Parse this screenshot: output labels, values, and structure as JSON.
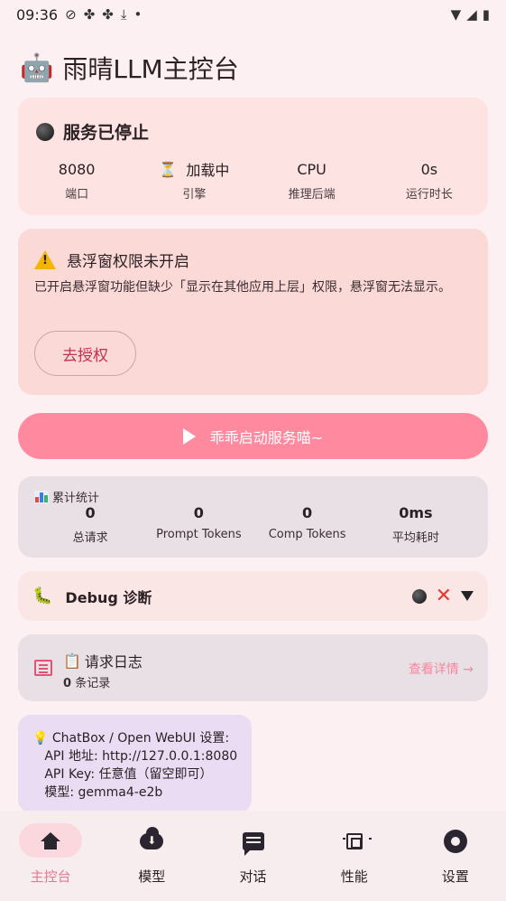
{
  "status_bar": {
    "time": "09:36",
    "notif_icons": [
      "hotspot-icon",
      "pinwheel-icon",
      "pinwheel-icon",
      "download-icon",
      "dot-icon"
    ],
    "system_icons": [
      "wifi-icon",
      "signal-icon",
      "battery-icon"
    ]
  },
  "app": {
    "title": "雨晴LLM主控台"
  },
  "service": {
    "status": "服务已停止",
    "stats": [
      {
        "value": "8080",
        "label": "端口"
      },
      {
        "value": "加载中",
        "label": "引擎"
      },
      {
        "value": "CPU",
        "label": "推理后端"
      },
      {
        "value": "0s",
        "label": "运行时长"
      }
    ]
  },
  "warning": {
    "title": "悬浮窗权限未开启",
    "body": "已开启悬浮窗功能但缺少「显示在其他应用上层」权限，悬浮窗无法显示。",
    "button": "去授权"
  },
  "start_button": {
    "label": "乖乖启动服务喵~"
  },
  "totals": {
    "title": "累计统计",
    "items": [
      {
        "value": "0",
        "label": "总请求"
      },
      {
        "value": "0",
        "label": "Prompt Tokens"
      },
      {
        "value": "0",
        "label": "Comp Tokens"
      },
      {
        "value": "0ms",
        "label": "平均耗时"
      }
    ]
  },
  "debug": {
    "title": "Debug 诊断"
  },
  "request_log": {
    "title": "请求日志",
    "count": "0",
    "count_suffix": "条记录",
    "link": "查看详情 →"
  },
  "tip": {
    "lines": "💡 ChatBox / Open WebUI 设置:\n   API 地址: http://127.0.0.1:8080\n   API Key: 任意值（留空即可）\n   模型: gemma4-e2b"
  },
  "nav": {
    "items": [
      {
        "label": "主控台",
        "icon": "home-icon",
        "active": true
      },
      {
        "label": "模型",
        "icon": "cloud-download-icon",
        "active": false
      },
      {
        "label": "对话",
        "icon": "chat-icon",
        "active": false
      },
      {
        "label": "性能",
        "icon": "chip-icon",
        "active": false
      },
      {
        "label": "设置",
        "icon": "gear-icon",
        "active": false
      }
    ]
  },
  "colors": {
    "background": "#fdf0f2",
    "accent": "#ff8aa0",
    "active_nav": "#e97892",
    "error_x": "#e53935"
  }
}
